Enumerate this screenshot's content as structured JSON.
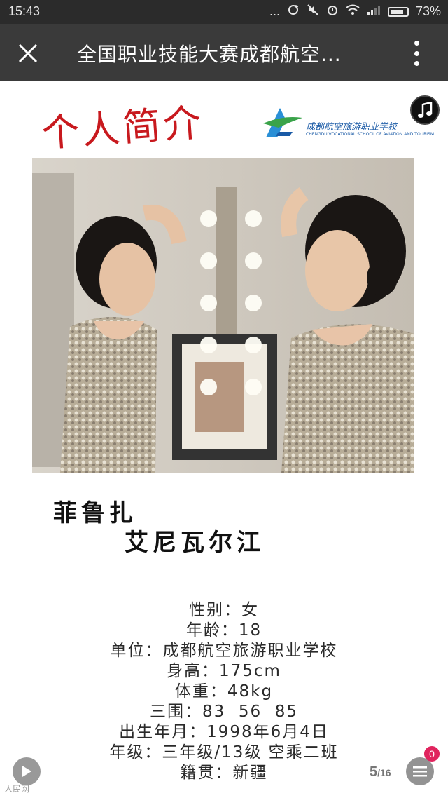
{
  "status_bar": {
    "time": "15:43",
    "dots": "...",
    "battery_percent": "73%"
  },
  "nav": {
    "title": "全国职业技能大赛成都航空..."
  },
  "poster": {
    "heading": "个人简介",
    "school_name": "成都航空旅游职业学校",
    "school_name_en": "CHENGDU VOCATIONAL SCHOOL OF AVIATION AND TOURISM",
    "name_line1": "菲鲁扎",
    "name_line2": "艾尼瓦尔江",
    "info": [
      "性别：女",
      "年龄：18",
      "单位：成都航空旅游职业学校",
      "身高：175cm",
      "体重：48kg",
      "三围：83  56  85",
      "出生年月：1998年6月4日",
      "年级：三年级/13级 空乘二班",
      "籍贯：新疆"
    ]
  },
  "footer": {
    "watermark": "人民网",
    "page_current": "5",
    "page_total": "/16",
    "badge_count": "0"
  },
  "colors": {
    "heading_red": "#c8191e",
    "school_blue": "#1a5aa6",
    "nav_bg": "#3a3a3a",
    "status_bg": "#2b2b2b"
  }
}
